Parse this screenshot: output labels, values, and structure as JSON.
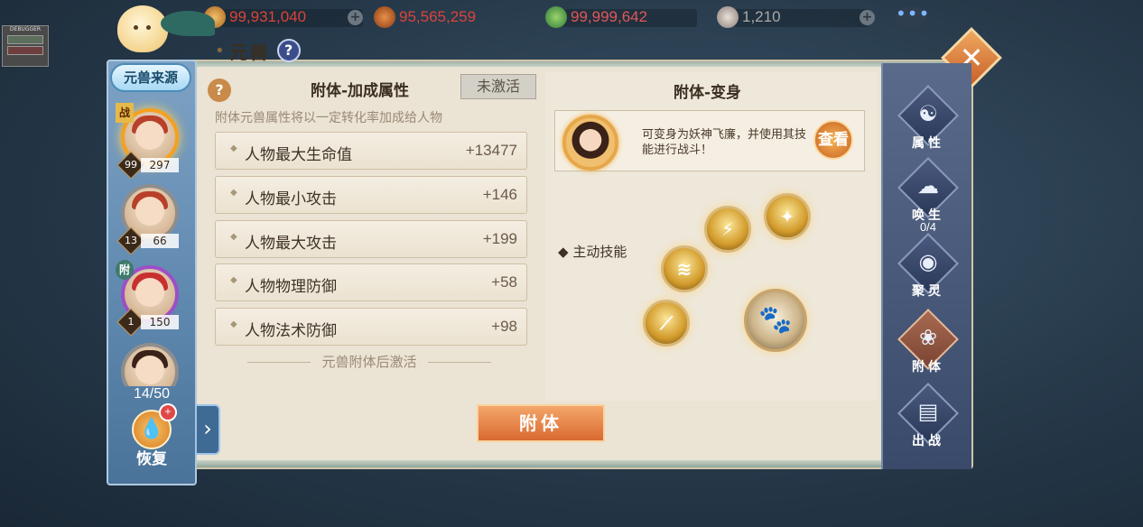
{
  "currencies": [
    {
      "name": "gold-coin-icon",
      "value": "99,931,040"
    },
    {
      "name": "copper-coin-icon",
      "value": "95,565,259"
    },
    {
      "name": "jade-icon",
      "value": "99,999,642"
    },
    {
      "name": "silver-ingot-icon",
      "value": "1,210"
    }
  ],
  "more_label": "•••",
  "debugger_label": "DEBUGGER",
  "title": "元兽",
  "source_button": "元兽来源",
  "pets": [
    {
      "tag": "战",
      "level": "99",
      "power": "297"
    },
    {
      "tag": "",
      "level": "13",
      "power": "66"
    },
    {
      "tag": "附",
      "level": "1",
      "power": "150"
    },
    {
      "tag": "",
      "level": "",
      "power": ""
    }
  ],
  "pet_count": "14/50",
  "recover_label": "恢复",
  "attr_section": {
    "title": "附体-加成属性",
    "status": "未激活",
    "note": "附体元兽属性将以一定转化率加成给人物",
    "rows": [
      {
        "name": "人物最大生命值",
        "value": "+13477"
      },
      {
        "name": "人物最小攻击",
        "value": "+146"
      },
      {
        "name": "人物最大攻击",
        "value": "+199"
      },
      {
        "name": "人物物理防御",
        "value": "+58"
      },
      {
        "name": "人物法术防御",
        "value": "+98"
      }
    ],
    "activate_note": "元兽附体后激活"
  },
  "transform_section": {
    "title": "附体-变身",
    "description": "可变身为妖神飞廉，并使用其技能进行战斗！",
    "view_button": "查看",
    "active_skill_label": "主动技能"
  },
  "attach_button": "附体",
  "nav": [
    {
      "icon": "taiji-icon",
      "label": "属性",
      "sub": ""
    },
    {
      "icon": "spirit-icon",
      "label": "唤生",
      "sub": "0/4"
    },
    {
      "icon": "gather-spirit-icon",
      "label": "聚灵",
      "sub": ""
    },
    {
      "icon": "attach-icon",
      "label": "附体",
      "sub": ""
    },
    {
      "icon": "battle-icon",
      "label": "出战",
      "sub": ""
    }
  ],
  "colors": {
    "panel_bg": "#ebe3d3",
    "accent_orange": "#d96a30",
    "nav_active": "#a86a52"
  }
}
